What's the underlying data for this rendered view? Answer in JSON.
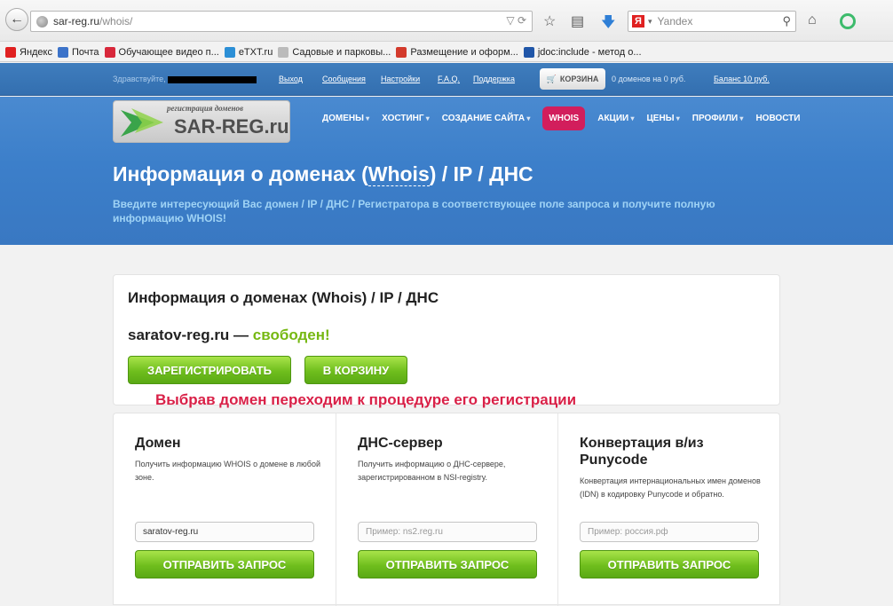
{
  "browser": {
    "url_host": "sar-reg.ru",
    "url_path": "/whois/",
    "search_placeholder": "Yandex"
  },
  "bookmarks": [
    {
      "label": "Яндекс",
      "color": "#e02020"
    },
    {
      "label": "Почта",
      "color": "#3c73c9"
    },
    {
      "label": "Обучающее видео п...",
      "color": "#d8283b"
    },
    {
      "label": "eTXT.ru",
      "color": "#2c8fd6"
    },
    {
      "label": "Садовые и парковы...",
      "color": "#bbbbbb"
    },
    {
      "label": "Размещение и оформ...",
      "color": "#d33a2c"
    },
    {
      "label": "jdoc:include - метод о...",
      "color": "#2056a8"
    }
  ],
  "topbar": {
    "greeting": "Здравствуйте,",
    "logout": "Выход",
    "messages": "Сообщения",
    "settings": "Настройки",
    "faq": "F.A.Q.",
    "support": "Поддержка",
    "cart": "КОРЗИНА",
    "cart_status": "0 доменов на 0 руб.",
    "balance": "Баланс 10 руб."
  },
  "logo": {
    "tagline": "регистрация доменов",
    "brand": "SAR-REG.ru"
  },
  "nav": [
    {
      "label": "ДОМЕНЫ",
      "dropdown": true
    },
    {
      "label": "ХОСТИНГ",
      "dropdown": true
    },
    {
      "label": "СОЗДАНИЕ САЙТА",
      "dropdown": true
    },
    {
      "label": "WHOIS",
      "active": true
    },
    {
      "label": "АКЦИИ",
      "dropdown": true
    },
    {
      "label": "ЦЕНЫ",
      "dropdown": true
    },
    {
      "label": "ПРОФИЛИ",
      "dropdown": true
    },
    {
      "label": "НОВОСТИ"
    }
  ],
  "header": {
    "title_prefix": "Информация о доменах (",
    "title_link": "Whois",
    "title_suffix": ") / IP / ДНС",
    "subtitle": "Введите интересующий Вас домен / IP / ДНС / Регистратора в соответствующее поле запроса и получите полную информацию WHOIS!"
  },
  "result": {
    "title": "Информация о доменах (Whois) / IP / ДНС",
    "domain": "saratov-reg.ru —",
    "status": "свободен!",
    "register_button": "ЗАРЕГИСТРИРОВАТЬ",
    "cart_button": "В КОРЗИНУ"
  },
  "annotation": "Выбрав домен переходим к процедуре его регистрации",
  "tools": [
    {
      "title": "Домен",
      "description": "Получить информацию WHOIS о домене в любой зоне.",
      "value": "saratov-reg.ru",
      "placeholder": "",
      "button": "ОТПРАВИТЬ ЗАПРОС"
    },
    {
      "title": "ДНС-сервер",
      "description": "Получить информацию о ДНС-сервере, зарегистрированном в NSI-registry.",
      "value": "",
      "placeholder": "Пример: ns2.reg.ru",
      "button": "ОТПРАВИТЬ ЗАПРОС"
    },
    {
      "title": "Конвертация в/из Punycode",
      "description": "Конвертация интернациональных имен доменов (IDN) в кодировку Punycode и обратно.",
      "value": "",
      "placeholder": "Пример: россия.рф",
      "button": "ОТПРАВИТЬ ЗАПРОС"
    }
  ],
  "colors": {
    "accent_green": "#76b812",
    "whois_active": "#d21e5c",
    "annotation_red": "#d92047",
    "header_blue": "#3c7fca"
  }
}
